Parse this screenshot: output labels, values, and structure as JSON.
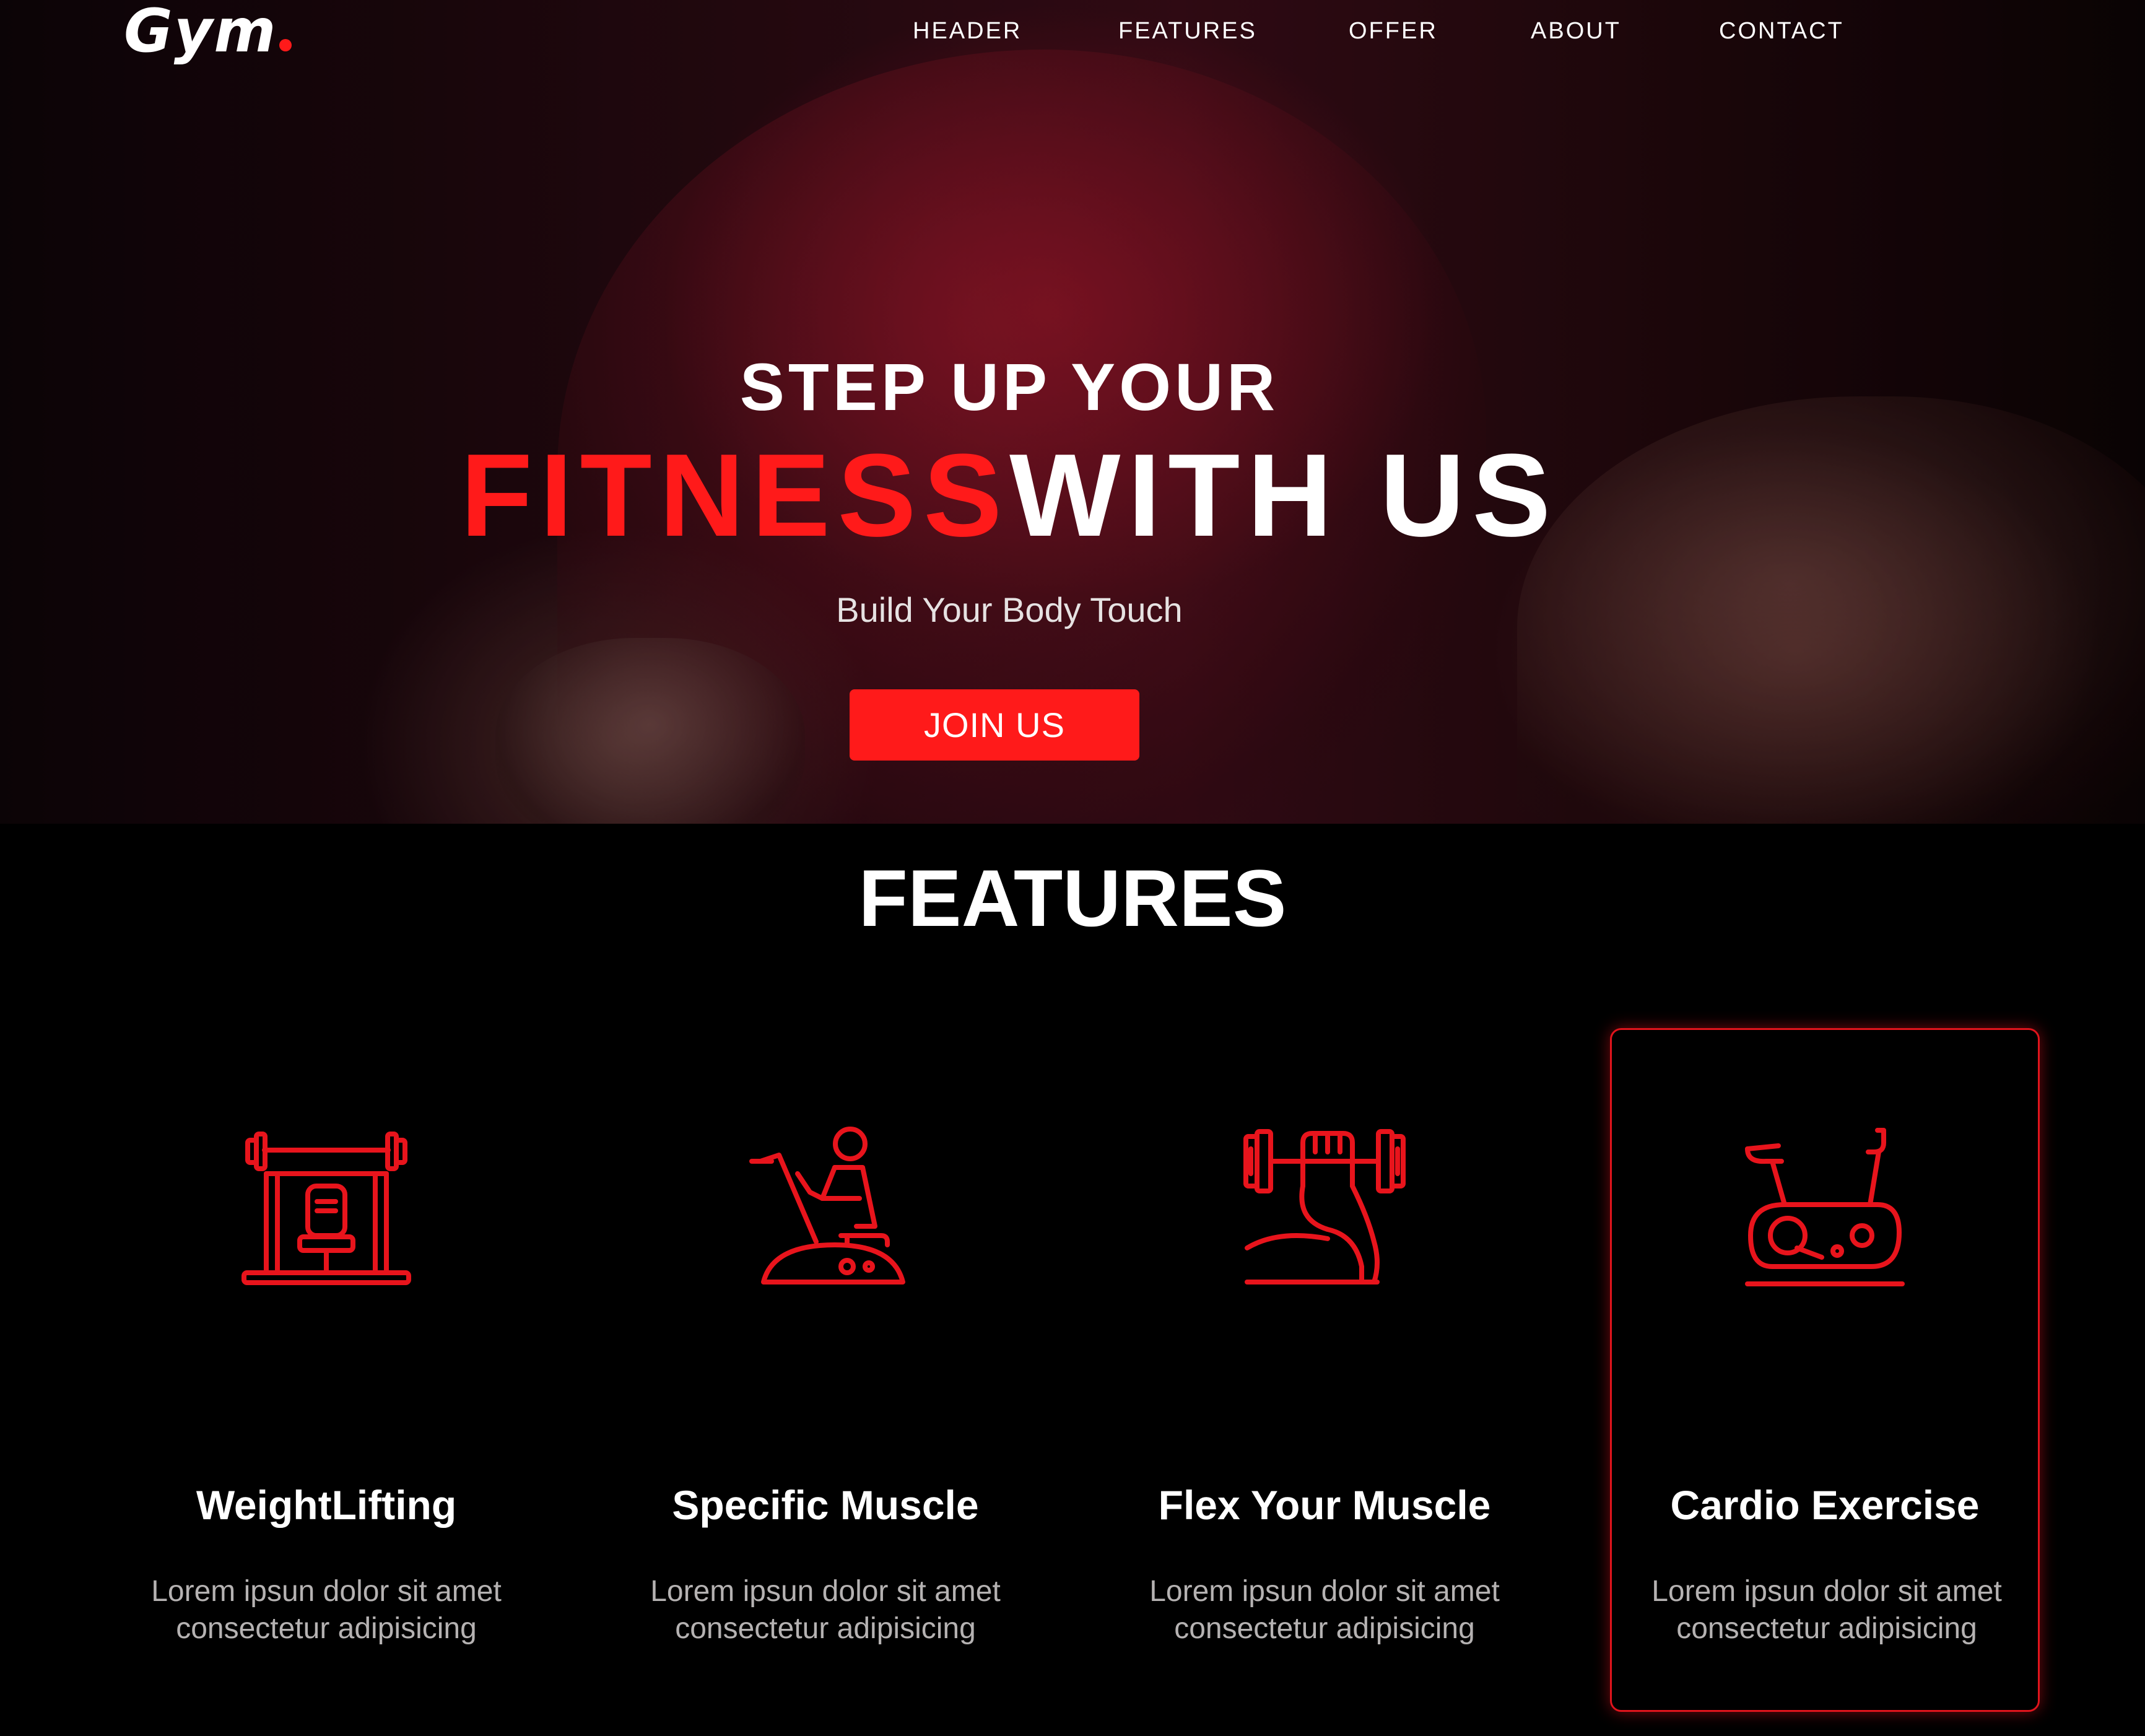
{
  "brand": {
    "logo_text": "Gym",
    "accent_color": "#ff1a1a",
    "background_color": "#000000"
  },
  "nav": {
    "items": [
      {
        "label": "HEADER"
      },
      {
        "label": "FEATURES"
      },
      {
        "label": "OFFER"
      },
      {
        "label": "ABOUT"
      },
      {
        "label": "CONTACT"
      }
    ]
  },
  "hero": {
    "line1": "STEP UP YOUR",
    "line2_accent": "FITNESS",
    "line2_rest": "WITH US",
    "subtitle": "Build Your Body Touch",
    "cta_label": "JOIN US"
  },
  "features": {
    "title": "FEATURES",
    "items": [
      {
        "icon": "weightlifting-bench-icon",
        "title": "WeightLifting",
        "text": "Lorem ipsun dolor sit amet consectetur adipisicing"
      },
      {
        "icon": "exercise-bike-rider-icon",
        "title": "Specific Muscle",
        "text": "Lorem ipsun dolor sit amet consectetur adipisicing"
      },
      {
        "icon": "dumbbell-arm-icon",
        "title": "Flex Your Muscle",
        "text": "Lorem ipsun dolor sit amet consectetur adipisicing"
      },
      {
        "icon": "stationary-bike-icon",
        "title": "Cardio Exercise",
        "text": "Lorem ipsun dolor sit amet consectetur adipisicing",
        "highlighted": true
      }
    ]
  }
}
